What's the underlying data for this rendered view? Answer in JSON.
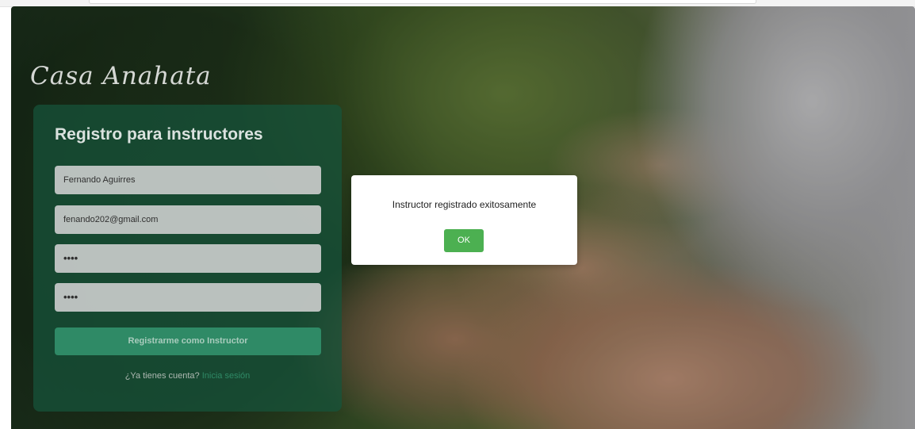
{
  "brand": {
    "logo_text": "Casa Anahata"
  },
  "register_form": {
    "title": "Registro para instructores",
    "name_value": "Fernando Aguirres",
    "email_value": "fenando202@gmail.com",
    "password_value": "••••",
    "confirm_password_value": "••••",
    "submit_label": "Registrarme como Instructor",
    "login_prompt": "¿Ya tienes cuenta?",
    "login_link": "Inicia sesión"
  },
  "alert": {
    "message": "Instructor registrado exitosamente",
    "ok_label": "OK"
  },
  "colors": {
    "card": "#16543c",
    "button": "#2f8a66",
    "ok_button": "#4cb051"
  }
}
